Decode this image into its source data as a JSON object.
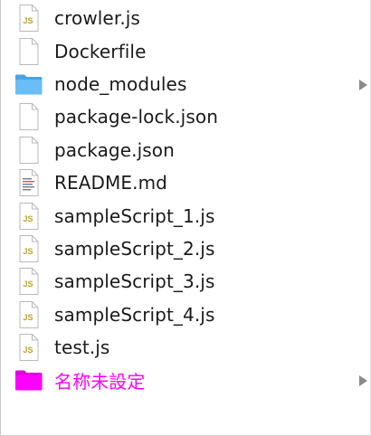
{
  "files": [
    {
      "name": "crowler.js",
      "icon": "js-file-icon"
    },
    {
      "name": "Dockerfile",
      "icon": "blank-file-icon"
    },
    {
      "name": "node_modules",
      "icon": "folder-icon"
    },
    {
      "name": "package-lock.json",
      "icon": "blank-file-icon"
    },
    {
      "name": "package.json",
      "icon": "blank-file-icon"
    },
    {
      "name": "README.md",
      "icon": "text-file-icon"
    },
    {
      "name": "sampleScript_1.js",
      "icon": "js-file-icon"
    },
    {
      "name": "sampleScript_2.js",
      "icon": "js-file-icon"
    },
    {
      "name": "sampleScript_3.js",
      "icon": "js-file-icon"
    },
    {
      "name": "sampleScript_4.js",
      "icon": "js-file-icon"
    },
    {
      "name": "test.js",
      "icon": "js-file-icon"
    },
    {
      "name": "名称未設定",
      "icon": "magenta-folder-icon"
    }
  ],
  "colors": {
    "text": "#1a1a1a",
    "folder_blue": "#5ab3ef",
    "magenta_folder": "#ff00ff",
    "magenta_label": "#ff00ff",
    "js_badge": "#b9a42a",
    "chevron": "#8a8a8a"
  }
}
